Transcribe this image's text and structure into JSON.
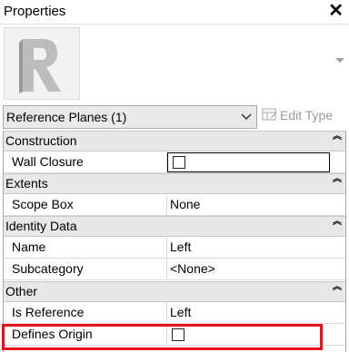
{
  "panel": {
    "title": "Properties"
  },
  "selector": {
    "type_label": "Reference Planes (1)",
    "edit_type_label": "Edit Type"
  },
  "sections": {
    "construction": "Construction",
    "extents": "Extents",
    "identity": "Identity Data",
    "other": "Other"
  },
  "props": {
    "wall_closure": {
      "name": "Wall Closure",
      "checked": false
    },
    "scope_box": {
      "name": "Scope Box",
      "value": "None"
    },
    "name": {
      "name": "Name",
      "value": "Left"
    },
    "subcategory": {
      "name": "Subcategory",
      "value": "<None>"
    },
    "is_reference": {
      "name": "Is Reference",
      "value": "Left"
    },
    "defines_origin": {
      "name": "Defines Origin",
      "checked": false
    }
  },
  "colors": {
    "highlight": "#e8121c",
    "section_bg": "#e8e8e8"
  },
  "icons": [
    "close-icon",
    "revit-logo",
    "chevron-down-icon",
    "edit-type-icon",
    "collapse-icon"
  ]
}
